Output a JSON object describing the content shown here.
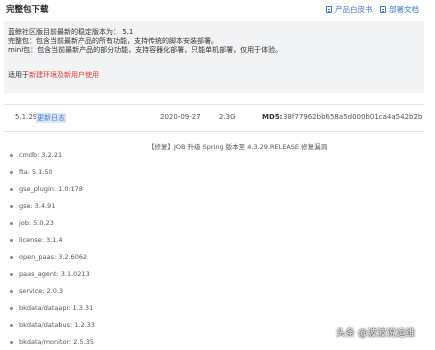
{
  "header": {
    "title": "完整包下载",
    "links": [
      {
        "label": "产品白皮书",
        "icon": "document-icon"
      },
      {
        "label": "部署文档",
        "icon": "document-icon"
      }
    ]
  },
  "notice": {
    "line1": "蓝鲸社区版目前最新的稳定版本为： 5.1",
    "line2": "完整包：包含当前最新产品的所有功能，支持传统的脚本安装部署。",
    "line3": "mini包：包含当前最新产品的部分功能，支持容器化部署，只能单机部署，仅用于体验。",
    "line4_prefix": "适用于",
    "line4_link": "新建环境及新用户使用"
  },
  "release": {
    "version": "5.1.29",
    "version_link": "更新日志",
    "date": "2020-09-27",
    "size": "2.3G",
    "md5_label": "MD5:",
    "md5_value": "38f77962bb658a5d000b01ca4a542b2b"
  },
  "release_note": "【修复】JOB 升级 Spring 版本至 4.3.29.RELEASE 修复漏洞",
  "components": [
    "cmdb: 3.2.21",
    "fta: 5.1.50",
    "gse_plugin: 1.0.178",
    "gse: 3.4.91",
    "job: 5.0.23",
    "license: 3.1.4",
    "open_paas: 3.2.6062",
    "paas_agent: 3.1.0213",
    "service: 2.0.3",
    "bkdata/dataapi: 1.3.31",
    "bkdata/databus: 1.2.33",
    "bkdata/monitor: 2.5.35"
  ],
  "watermark": "头条 @波波说运维",
  "colors": {
    "link": "#3a7bd5",
    "highlight": "#e53935",
    "notice_bg": "#f2f3f5"
  }
}
